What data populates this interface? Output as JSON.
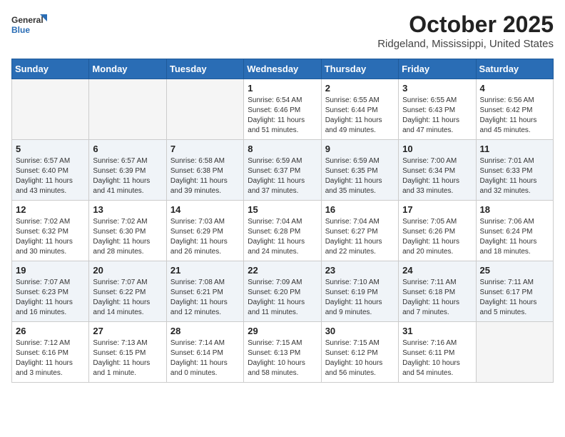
{
  "logo": {
    "line1": "General",
    "line2": "Blue"
  },
  "title": "October 2025",
  "subtitle": "Ridgeland, Mississippi, United States",
  "weekdays": [
    "Sunday",
    "Monday",
    "Tuesday",
    "Wednesday",
    "Thursday",
    "Friday",
    "Saturday"
  ],
  "weeks": [
    [
      {
        "day": "",
        "info": ""
      },
      {
        "day": "",
        "info": ""
      },
      {
        "day": "",
        "info": ""
      },
      {
        "day": "1",
        "info": "Sunrise: 6:54 AM\nSunset: 6:46 PM\nDaylight: 11 hours\nand 51 minutes."
      },
      {
        "day": "2",
        "info": "Sunrise: 6:55 AM\nSunset: 6:44 PM\nDaylight: 11 hours\nand 49 minutes."
      },
      {
        "day": "3",
        "info": "Sunrise: 6:55 AM\nSunset: 6:43 PM\nDaylight: 11 hours\nand 47 minutes."
      },
      {
        "day": "4",
        "info": "Sunrise: 6:56 AM\nSunset: 6:42 PM\nDaylight: 11 hours\nand 45 minutes."
      }
    ],
    [
      {
        "day": "5",
        "info": "Sunrise: 6:57 AM\nSunset: 6:40 PM\nDaylight: 11 hours\nand 43 minutes."
      },
      {
        "day": "6",
        "info": "Sunrise: 6:57 AM\nSunset: 6:39 PM\nDaylight: 11 hours\nand 41 minutes."
      },
      {
        "day": "7",
        "info": "Sunrise: 6:58 AM\nSunset: 6:38 PM\nDaylight: 11 hours\nand 39 minutes."
      },
      {
        "day": "8",
        "info": "Sunrise: 6:59 AM\nSunset: 6:37 PM\nDaylight: 11 hours\nand 37 minutes."
      },
      {
        "day": "9",
        "info": "Sunrise: 6:59 AM\nSunset: 6:35 PM\nDaylight: 11 hours\nand 35 minutes."
      },
      {
        "day": "10",
        "info": "Sunrise: 7:00 AM\nSunset: 6:34 PM\nDaylight: 11 hours\nand 33 minutes."
      },
      {
        "day": "11",
        "info": "Sunrise: 7:01 AM\nSunset: 6:33 PM\nDaylight: 11 hours\nand 32 minutes."
      }
    ],
    [
      {
        "day": "12",
        "info": "Sunrise: 7:02 AM\nSunset: 6:32 PM\nDaylight: 11 hours\nand 30 minutes."
      },
      {
        "day": "13",
        "info": "Sunrise: 7:02 AM\nSunset: 6:30 PM\nDaylight: 11 hours\nand 28 minutes."
      },
      {
        "day": "14",
        "info": "Sunrise: 7:03 AM\nSunset: 6:29 PM\nDaylight: 11 hours\nand 26 minutes."
      },
      {
        "day": "15",
        "info": "Sunrise: 7:04 AM\nSunset: 6:28 PM\nDaylight: 11 hours\nand 24 minutes."
      },
      {
        "day": "16",
        "info": "Sunrise: 7:04 AM\nSunset: 6:27 PM\nDaylight: 11 hours\nand 22 minutes."
      },
      {
        "day": "17",
        "info": "Sunrise: 7:05 AM\nSunset: 6:26 PM\nDaylight: 11 hours\nand 20 minutes."
      },
      {
        "day": "18",
        "info": "Sunrise: 7:06 AM\nSunset: 6:24 PM\nDaylight: 11 hours\nand 18 minutes."
      }
    ],
    [
      {
        "day": "19",
        "info": "Sunrise: 7:07 AM\nSunset: 6:23 PM\nDaylight: 11 hours\nand 16 minutes."
      },
      {
        "day": "20",
        "info": "Sunrise: 7:07 AM\nSunset: 6:22 PM\nDaylight: 11 hours\nand 14 minutes."
      },
      {
        "day": "21",
        "info": "Sunrise: 7:08 AM\nSunset: 6:21 PM\nDaylight: 11 hours\nand 12 minutes."
      },
      {
        "day": "22",
        "info": "Sunrise: 7:09 AM\nSunset: 6:20 PM\nDaylight: 11 hours\nand 11 minutes."
      },
      {
        "day": "23",
        "info": "Sunrise: 7:10 AM\nSunset: 6:19 PM\nDaylight: 11 hours\nand 9 minutes."
      },
      {
        "day": "24",
        "info": "Sunrise: 7:11 AM\nSunset: 6:18 PM\nDaylight: 11 hours\nand 7 minutes."
      },
      {
        "day": "25",
        "info": "Sunrise: 7:11 AM\nSunset: 6:17 PM\nDaylight: 11 hours\nand 5 minutes."
      }
    ],
    [
      {
        "day": "26",
        "info": "Sunrise: 7:12 AM\nSunset: 6:16 PM\nDaylight: 11 hours\nand 3 minutes."
      },
      {
        "day": "27",
        "info": "Sunrise: 7:13 AM\nSunset: 6:15 PM\nDaylight: 11 hours\nand 1 minute."
      },
      {
        "day": "28",
        "info": "Sunrise: 7:14 AM\nSunset: 6:14 PM\nDaylight: 11 hours\nand 0 minutes."
      },
      {
        "day": "29",
        "info": "Sunrise: 7:15 AM\nSunset: 6:13 PM\nDaylight: 10 hours\nand 58 minutes."
      },
      {
        "day": "30",
        "info": "Sunrise: 7:15 AM\nSunset: 6:12 PM\nDaylight: 10 hours\nand 56 minutes."
      },
      {
        "day": "31",
        "info": "Sunrise: 7:16 AM\nSunset: 6:11 PM\nDaylight: 10 hours\nand 54 minutes."
      },
      {
        "day": "",
        "info": ""
      }
    ]
  ],
  "colors": {
    "header_bg": "#2a6db5",
    "shaded_row": "#f0f4f8"
  }
}
